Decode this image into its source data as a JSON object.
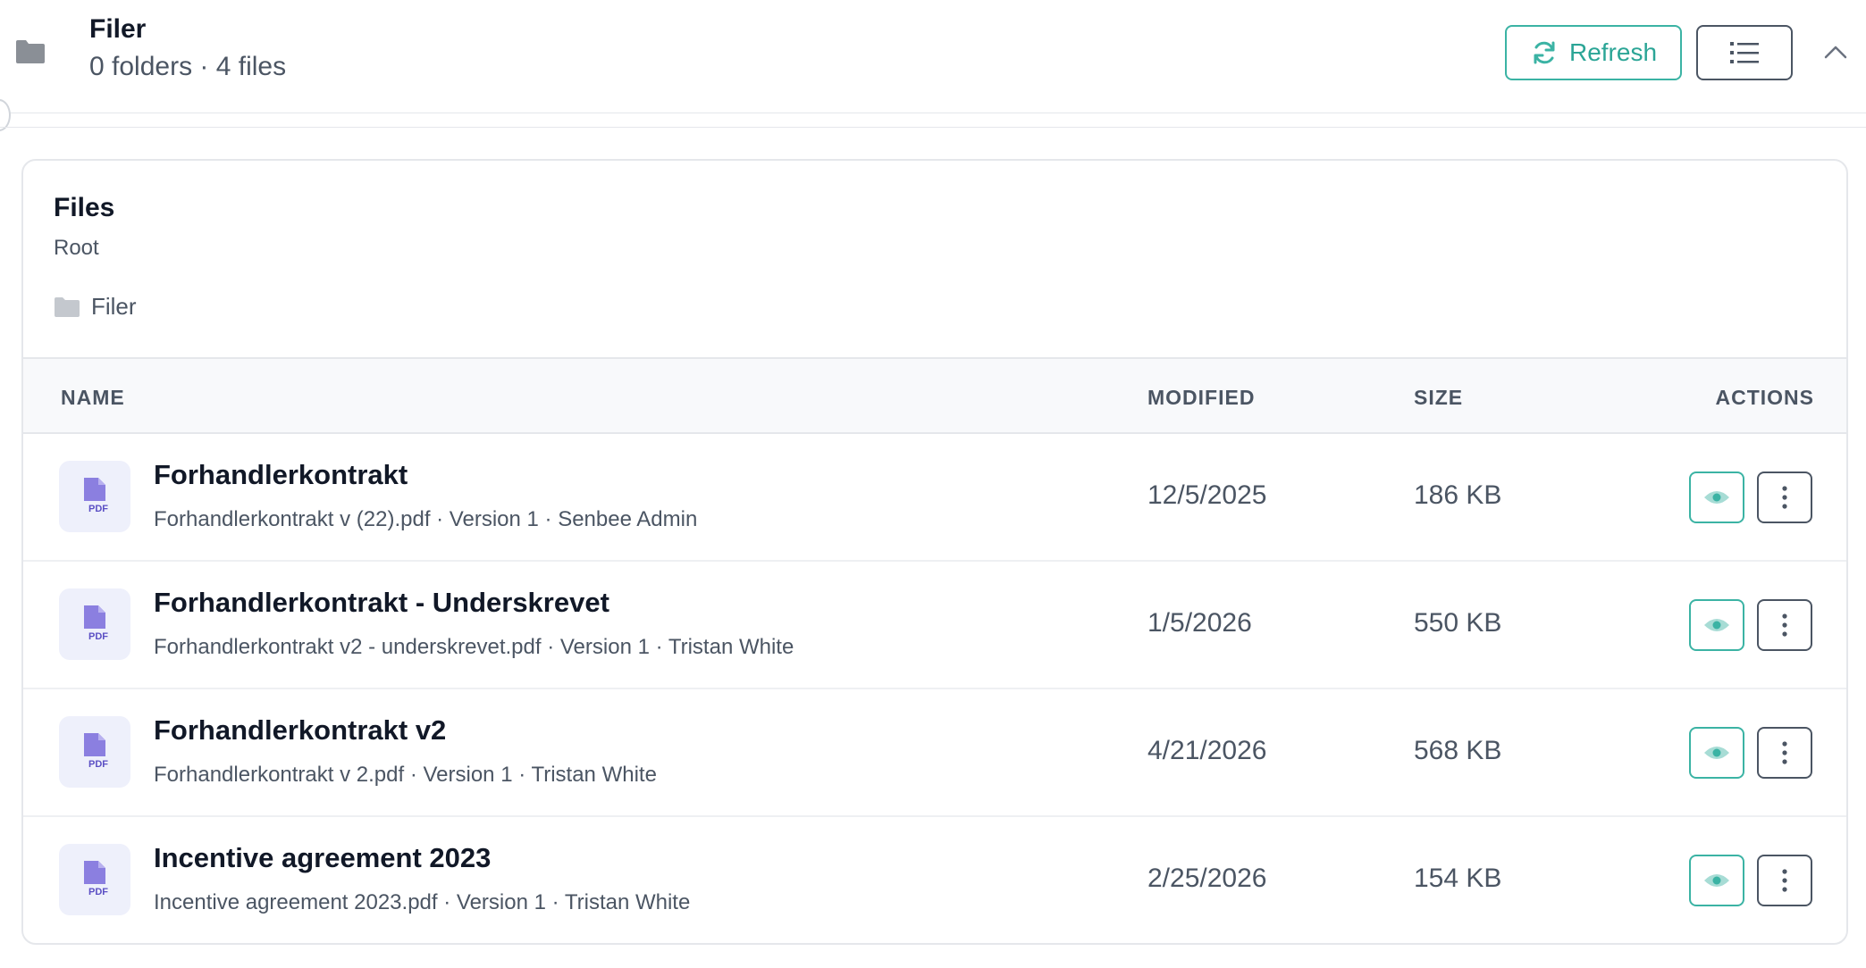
{
  "header": {
    "title": "Filer",
    "subtitle": "0 folders · 4 files",
    "refresh_label": "Refresh"
  },
  "card": {
    "title": "Files",
    "subtitle": "Root",
    "breadcrumb": "Filer"
  },
  "table": {
    "columns": {
      "name": "NAME",
      "modified": "MODIFIED",
      "size": "SIZE",
      "actions": "ACTIONS"
    },
    "rows": [
      {
        "name": "Forhandlerkontrakt",
        "meta": "Forhandlerkontrakt v (22).pdf · Version 1 · Senbee Admin",
        "modified": "12/5/2025",
        "size": "186 KB",
        "type_label": "PDF"
      },
      {
        "name": "Forhandlerkontrakt - Underskrevet",
        "meta": "Forhandlerkontrakt v2 - underskrevet.pdf · Version 1 · Tristan White",
        "modified": "1/5/2026",
        "size": "550 KB",
        "type_label": "PDF"
      },
      {
        "name": "Forhandlerkontrakt v2",
        "meta": "Forhandlerkontrakt v 2.pdf · Version 1 · Tristan White",
        "modified": "4/21/2026",
        "size": "568 KB",
        "type_label": "PDF"
      },
      {
        "name": "Incentive agreement 2023",
        "meta": "Incentive agreement 2023.pdf · Version 1 · Tristan White",
        "modified": "2/25/2026",
        "size": "154 KB",
        "type_label": "PDF"
      }
    ]
  },
  "colors": {
    "accent": "#3bb3a4",
    "pdf_icon": "#8b7fe0",
    "pdf_icon_bg": "#eef0fb",
    "folder_icon": "#8a8f96"
  },
  "icons": {
    "header_folder": "folder-icon",
    "refresh": "refresh-icon",
    "view_toggle": "list-view-icon",
    "collapse": "chevron-up-icon",
    "row_file": "pdf-file-icon",
    "row_view": "eye-icon",
    "row_more": "more-vertical-icon"
  }
}
